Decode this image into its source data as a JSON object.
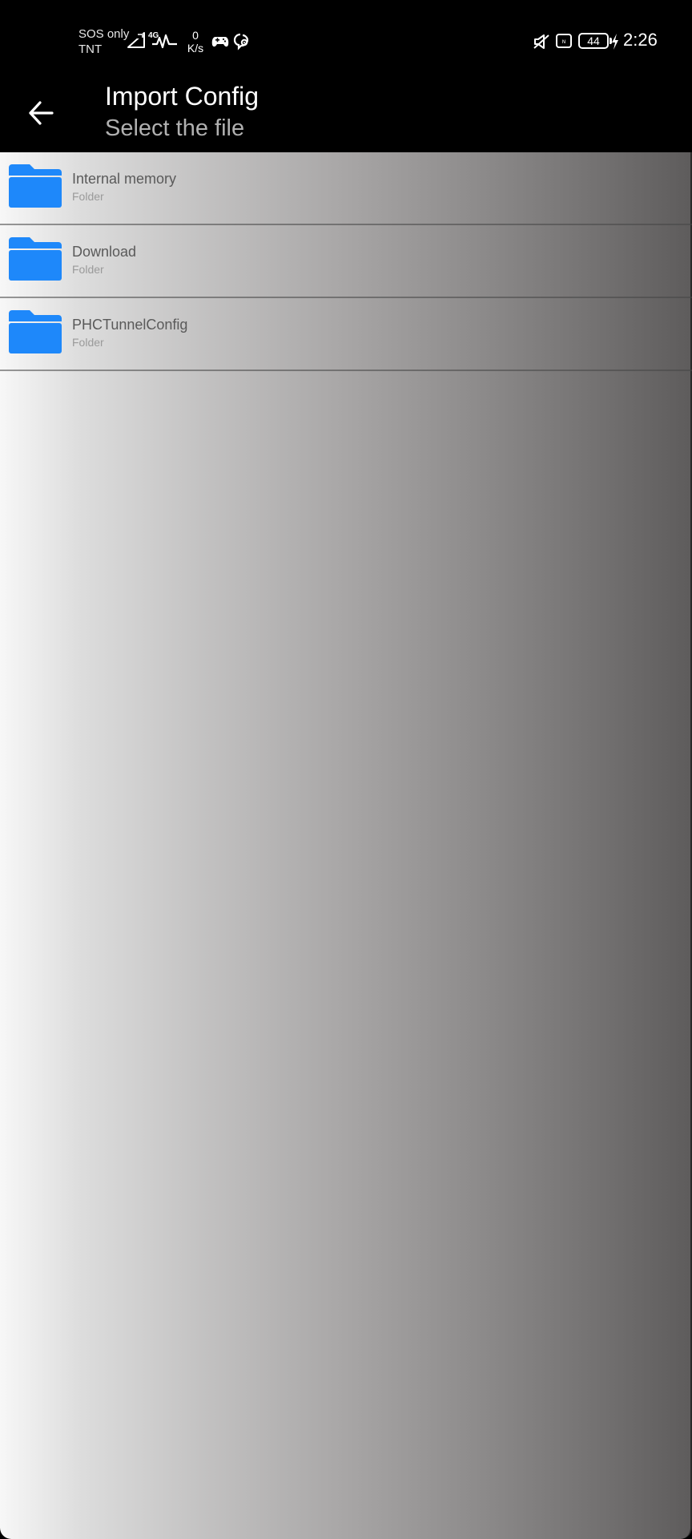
{
  "status_bar": {
    "carrier_line1": "SOS only",
    "carrier_line2": "TNT",
    "network_type": "4G",
    "speed_value": "0",
    "speed_unit": "K/s",
    "battery_level": "44",
    "time": "2:26",
    "icons": [
      "no-sim-signal-icon",
      "4g-activity-icon",
      "gamepad-icon",
      "app-notification-icon",
      "mute-icon",
      "nfc-icon",
      "battery-icon",
      "charging-icon"
    ]
  },
  "app_bar": {
    "title": "Import Config",
    "subtitle": "Select the file",
    "back_icon": "back-arrow-icon"
  },
  "files": [
    {
      "name": "Internal memory",
      "type": "Folder",
      "icon": "folder-icon"
    },
    {
      "name": "Download",
      "type": "Folder",
      "icon": "folder-icon"
    },
    {
      "name": "PHCTunnelConfig",
      "type": "Folder",
      "icon": "folder-icon"
    }
  ],
  "colors": {
    "folder_blue": "#1E88FA",
    "bar_background": "#000000",
    "title_text": "#FFFFFF",
    "subtitle_text": "#B0B0B0"
  }
}
